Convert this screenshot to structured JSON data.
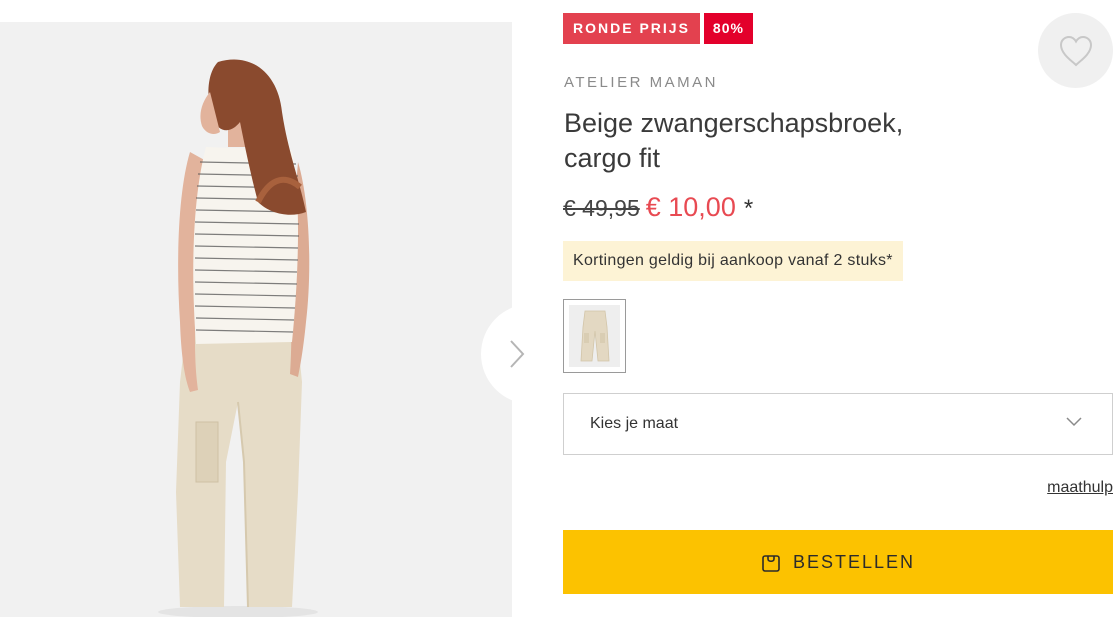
{
  "badges": {
    "round_price": "RONDE PRIJS",
    "discount": "80%"
  },
  "product": {
    "brand": "ATELIER MAMAN",
    "title_line1": "Beige zwangerschapsbroek,",
    "title_line2": "cargo fit",
    "price_old": "€ 49,95",
    "price_new": "€ 10,00",
    "price_note": "*"
  },
  "notice": "Kortingen geldig bij aankoop vanaf 2 stuks*",
  "size_select": {
    "label": "Kies je maat"
  },
  "size_help": "maathulp",
  "order_button": {
    "label": "BESTELLEN"
  },
  "colors": {
    "badge_round": "#e3414f",
    "badge_discount": "#e3002b",
    "sale_price": "#e84a52",
    "notice_bg": "#fdf3d5",
    "order_bg": "#fcc200"
  },
  "icons": [
    "chevron-right-icon",
    "heart-icon",
    "chevron-down-icon",
    "shopping-bag-icon"
  ]
}
